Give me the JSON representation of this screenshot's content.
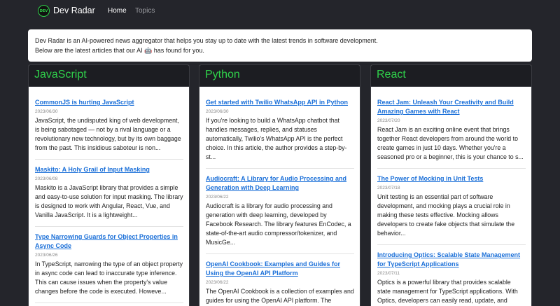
{
  "nav": {
    "logo_text": "DEV",
    "brand": "Dev Radar",
    "links": [
      {
        "label": "Home"
      },
      {
        "label": "Topics"
      }
    ]
  },
  "intro": {
    "line1": "Dev Radar is an AI-powered news aggregator that helps you stay up to date with the latest trends in software development.",
    "line2": "Below are the latest articles that our AI 🤖 has found for you."
  },
  "columns": [
    {
      "title": "JavaScript",
      "articles": [
        {
          "title": "CommonJS is hurting JavaScript",
          "date": "2023/06/30",
          "summary": "JavaScript, the undisputed king of web development, is being sabotaged — not by a rival language or a revolutionary new technology, but by its own baggage from the past. This insidious saboteur is non..."
        },
        {
          "title": "Maskito: A Holy Grail of Input Masking",
          "date": "2023/06/08",
          "summary": "Maskito is a JavaScript library that provides a simple and easy-to-use solution for input masking. The library is designed to work with Angular, React, Vue, and Vanilla JavaScript. It is a lightweight..."
        },
        {
          "title": "Type Narrowing Guards for Object Properties in Async Code",
          "date": "2023/06/26",
          "summary": "In TypeScript, narrowing the type of an object property in async code can lead to inaccurate type inference. This can cause issues when the property's value changes before the code is executed. Howeve..."
        }
      ]
    },
    {
      "title": "Python",
      "articles": [
        {
          "title": "Get started with Twilio WhatsApp API in Python",
          "date": "2023/06/30",
          "summary": "If you're looking to build a WhatsApp chatbot that handles messages, replies, and statuses automatically, Twilio's WhatsApp API is the perfect choice. In this article, the author provides a step-by-st..."
        },
        {
          "title": "Audiocraft: A Library for Audio Processing and Generation with Deep Learning",
          "date": "2023/06/22",
          "summary": "Audiocraft is a library for audio processing and generation with deep learning, developed by Facebook Research. The library features EnCodec, a state-of-the-art audio compressor/tokenizer, and MusicGe..."
        },
        {
          "title": "OpenAI Cookbook: Examples and Guides for Using the OpenAI API Platform",
          "date": "2023/06/22",
          "summary": "The OpenAI Cookbook is a collection of examples and guides for using the OpenAI API platform. The"
        }
      ]
    },
    {
      "title": "React",
      "articles": [
        {
          "title": "React Jam: Unleash Your Creativity and Build Amazing Games with React",
          "date": "2023/07/20",
          "summary": "React Jam is an exciting online event that brings together React developers from around the world to create games in just 10 days. Whether you're a seasoned pro or a beginner, this is your chance to s..."
        },
        {
          "title": "The Power of Mocking in Unit Tests",
          "date": "2023/07/18",
          "summary": "Unit testing is an essential part of software development, and mocking plays a crucial role in making these tests effective. Mocking allows developers to create fake objects that simulate the behavior..."
        },
        {
          "title": "Introducing Optics: Scalable State Management for TypeScript Applications",
          "date": "2023/07/11",
          "summary": "Optics is a powerful library that provides scalable state management for TypeScript applications. With Optics, developers can easily read, update, and"
        }
      ]
    }
  ]
}
